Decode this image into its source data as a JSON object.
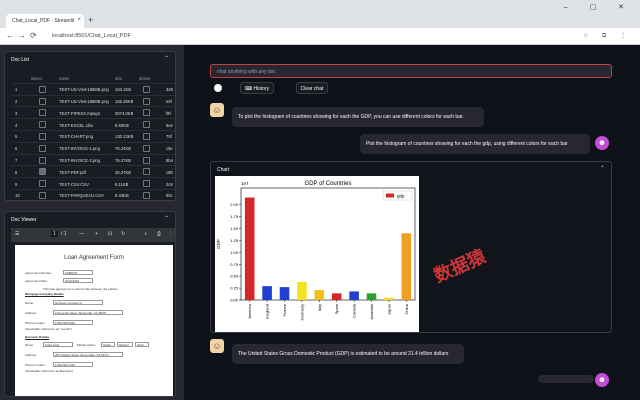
{
  "browser": {
    "tab_title": "Chat_Local_PDF · Streamlit",
    "tab_close": "×",
    "new_tab": "+",
    "window_controls": "– ▢ ✕",
    "url": "localhost:8501/Chat_Local_PDF",
    "nav_back": "←",
    "nav_forward": "→",
    "nav_reload": "⟳"
  },
  "doc_list": {
    "title": "Doc List",
    "chevron": "⌃",
    "columns": [
      "",
      "select",
      "name",
      "size",
      "delete",
      ""
    ],
    "rows": [
      {
        "index": "1",
        "name": "TEST-US-Visit-188MB.png",
        "size": "163.1KB",
        "selected": false,
        "extra": "326"
      },
      {
        "index": "2",
        "name": "TEST-US-Visit-188MB.png",
        "size": "165.36KB",
        "selected": false,
        "extra": "e5f"
      },
      {
        "index": "3",
        "name": "TEST-PIPESX.mpeg4",
        "size": "3074.0KB",
        "selected": false,
        "extra": "f9f"
      },
      {
        "index": "4",
        "name": "TEST-EXCEL.xlsx",
        "size": "8.60KB",
        "selected": false,
        "extra": "8ee"
      },
      {
        "index": "5",
        "name": "TEST-CHART.png",
        "size": "130.13KB",
        "selected": false,
        "extra": "75f"
      },
      {
        "index": "6",
        "name": "TEST-INVOICE-1.png",
        "size": "76.24KB",
        "selected": false,
        "extra": "c5e"
      },
      {
        "index": "7",
        "name": "TEST-INVOICE-2.png",
        "size": "76.27KB",
        "selected": false,
        "extra": "8b4"
      },
      {
        "index": "8",
        "name": "TEST-PDF.pdf",
        "size": "36.27KB",
        "selected": true,
        "extra": "c88"
      },
      {
        "index": "9",
        "name": "TEST-CSV.CSV",
        "size": "8.11KB",
        "selected": false,
        "extra": "2c8"
      },
      {
        "index": "10",
        "name": "TEST-PARQUEAU.CSV",
        "size": "8.33KB",
        "selected": false,
        "extra": "90c"
      }
    ],
    "scroll_indicator": "▶"
  },
  "doc_viewer": {
    "title": "Doc Viewer",
    "chevron": "⌃",
    "toolbar": {
      "menu": "☰",
      "page": "1",
      "page_total": "/ 1",
      "zoom_out": "—",
      "zoom_in": "+",
      "fit": "⊡",
      "rotate": "↻",
      "download": "⭳",
      "print": "⎙",
      "more": "⋮"
    },
    "form_title": "Loan Agreement Form",
    "agreement_number_label": "Agreement Number:",
    "agreement_number": "FOB4978",
    "agreement_date_label": "Agreement Date:",
    "agreement_date": "10/01/2023",
    "intro": "This loan agreement is entered into between the parties:",
    "lender_section": "Mortgage Company Details",
    "name_label": "Name:",
    "lender_name": "Mortgage Company A",
    "address_label": "Address:",
    "lender_address": "123 Lender Street, Moneyville, CA 45678",
    "phone_label": "Phone number:",
    "lender_phone": "1-800-555-5632",
    "lender_note": "(hereinafter referred to as \"Lender\")",
    "borrower_section": "Borrower Details",
    "borrower_name": "Angie Foter",
    "marital_label": "Marital status:",
    "marital_options": [
      "Single",
      "Married",
      "Other"
    ],
    "borrower_address": "200 Cashins Street, Moneyvilles, CA 63721",
    "borrower_phone": "1-800-555-7234",
    "borrower_note": "(hereinafter referred to as Borrower)"
  },
  "chat": {
    "input_placeholder": "chat anything with any doc",
    "history_button": "History",
    "history_icon": "⌨",
    "clear_button": "Clear chat",
    "bot_avatar": "☺",
    "user_avatar": "☻",
    "messages": [
      {
        "role": "assistant",
        "text": "To plot the histogram of countries showing for each the GDP, you can use different colors for each bar."
      },
      {
        "role": "user",
        "text": "Plot the histogram of countries showing for each the gdp, using different colors for each bar"
      },
      {
        "role": "assistant",
        "text": "The United States Gross Domestic Product (GDP) is estimated to be around 21.4 trillion dollars"
      }
    ],
    "chart_panel_label": "Chart",
    "chart_panel_chevron": "⌃"
  },
  "watermark": "数据猿",
  "chart_data": {
    "type": "bar",
    "title": "GDP of Countries",
    "xlabel": "",
    "ylabel": "GDP",
    "offset_label": "1e7",
    "legend": [
      "gdp"
    ],
    "legend_position": "top-right",
    "categories": [
      "America",
      "England",
      "France",
      "Germany",
      "Italy",
      "Spain",
      "Canada",
      "Australia",
      "Japan",
      "China"
    ],
    "values": [
      2.15,
      0.29,
      0.27,
      0.38,
      0.21,
      0.14,
      0.18,
      0.14,
      0.05,
      1.4
    ],
    "colors": [
      "#d62728",
      "#1f3fd1",
      "#1f3fd1",
      "#f2e21f",
      "#f2c01f",
      "#d62728",
      "#1f3fd1",
      "#2ca02c",
      "#f2e21f",
      "#f0a020"
    ],
    "ylim": [
      0,
      2.35
    ],
    "yticks": [
      0.0,
      0.25,
      0.5,
      0.75,
      1.0,
      1.25,
      1.5,
      1.75,
      2.0
    ]
  }
}
